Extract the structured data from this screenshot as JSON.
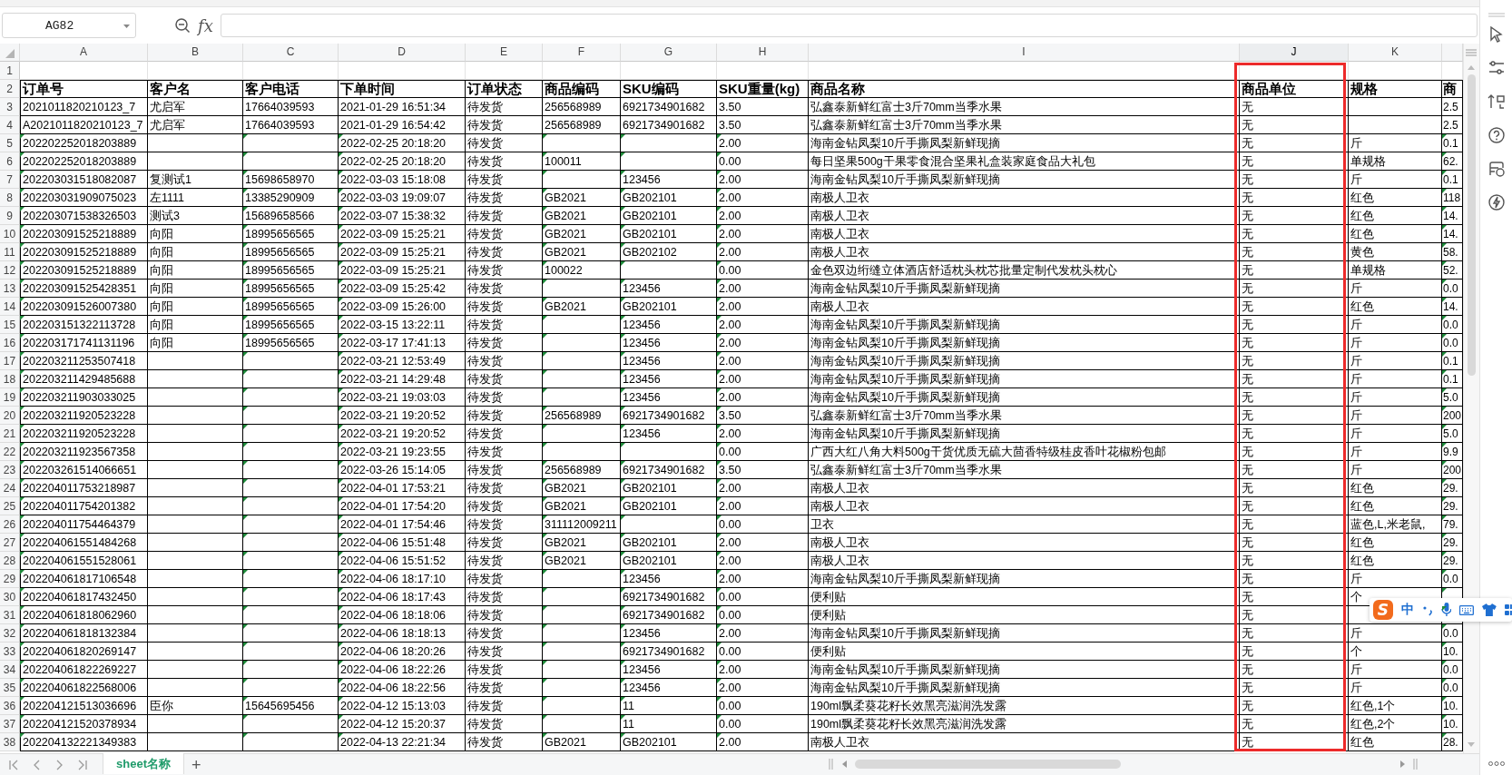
{
  "name_box": {
    "value": "AG82"
  },
  "formula_bar": {
    "fx": "fx"
  },
  "columns": [
    {
      "letter": "A",
      "highlighted": false,
      "flag_marks": true
    },
    {
      "letter": "B",
      "highlighted": false,
      "flag_marks": false
    },
    {
      "letter": "C",
      "highlighted": false,
      "flag_marks": true
    },
    {
      "letter": "D",
      "highlighted": false,
      "flag_marks": true
    },
    {
      "letter": "E",
      "highlighted": false,
      "flag_marks": false
    },
    {
      "letter": "F",
      "highlighted": false,
      "flag_marks": true
    },
    {
      "letter": "G",
      "highlighted": false,
      "flag_marks": true
    },
    {
      "letter": "H",
      "highlighted": false,
      "flag_marks": true
    },
    {
      "letter": "I",
      "highlighted": false,
      "flag_marks": false
    },
    {
      "letter": "J",
      "highlighted": true,
      "flag_marks": false
    },
    {
      "letter": "K",
      "highlighted": false,
      "flag_marks": false
    },
    {
      "highlighted": false,
      "flag_marks": true
    }
  ],
  "rows": [
    {
      "number": "1",
      "kind": "blank"
    },
    {
      "number": "2",
      "kind": "header",
      "cells": [
        "订单号",
        "客户名",
        "客户电话",
        "下单时间",
        "订单状态",
        "商品编码",
        "SKU编码",
        "SKU重量(kg)",
        "商品名称",
        "商品单位",
        "规格",
        "商"
      ]
    },
    {
      "number": "3",
      "kind": "data",
      "flagged": false,
      "cells": [
        "2021011820210123_7",
        "尤启军",
        "17664039593",
        "2021-01-29 16:51:34",
        "待发货",
        "256568989",
        "6921734901682",
        "3.50",
        "弘鑫泰新鲜红富士3斤70mm当季水果",
        "无",
        null,
        "2.5"
      ]
    },
    {
      "number": "4",
      "kind": "data",
      "flagged": false,
      "cells": [
        "A2021011820210123_7",
        "尤启军",
        "17664039593",
        "2021-01-29 16:54:42",
        "待发货",
        "256568989",
        "6921734901682",
        "3.50",
        "弘鑫泰新鲜红富士3斤70mm当季水果",
        "无",
        null,
        "2.5"
      ]
    },
    {
      "number": "5",
      "kind": "data",
      "flagged": true,
      "cells": [
        "202202252018203889",
        null,
        null,
        "2022-02-25 20:18:20",
        "待发货",
        null,
        null,
        "2.00",
        "海南金钻凤梨10斤手撕凤梨新鲜现摘",
        "无",
        "斤",
        "0.1"
      ]
    },
    {
      "number": "6",
      "kind": "data",
      "flagged": true,
      "cells": [
        "202202252018203889",
        null,
        null,
        "2022-02-25 20:18:20",
        "待发货",
        "100011",
        null,
        "0.00",
        "每日坚果500g干果零食混合坚果礼盒装家庭食品大礼包",
        "无",
        "单规格",
        "62."
      ]
    },
    {
      "number": "7",
      "kind": "data",
      "flagged": true,
      "cells": [
        "202203031518082087",
        "复测试1",
        "15698658970",
        "2022-03-03 15:18:08",
        "待发货",
        null,
        "123456",
        "2.00",
        "海南金钻凤梨10斤手撕凤梨新鲜现摘",
        "无",
        "斤",
        "0.1"
      ]
    },
    {
      "number": "8",
      "kind": "data",
      "flagged": true,
      "cells": [
        "202203031909075023",
        "左1111",
        "13385290909",
        "2022-03-03 19:09:07",
        "待发货",
        "GB2021",
        "GB202101",
        "2.00",
        "南极人卫衣",
        "无",
        "红色",
        "118"
      ]
    },
    {
      "number": "9",
      "kind": "data",
      "flagged": true,
      "cells": [
        "202203071538326503",
        "测试3",
        "15689658566",
        "2022-03-07 15:38:32",
        "待发货",
        "GB2021",
        "GB202101",
        "2.00",
        "南极人卫衣",
        "无",
        "红色",
        "14."
      ]
    },
    {
      "number": "10",
      "kind": "data",
      "flagged": true,
      "cells": [
        "202203091525218889",
        "向阳",
        "18995656565",
        "2022-03-09 15:25:21",
        "待发货",
        "GB2021",
        "GB202101",
        "2.00",
        "南极人卫衣",
        "无",
        "红色",
        "14."
      ]
    },
    {
      "number": "11",
      "kind": "data",
      "flagged": true,
      "cells": [
        "202203091525218889",
        "向阳",
        "18995656565",
        "2022-03-09 15:25:21",
        "待发货",
        "GB2021",
        "GB202102",
        "2.00",
        "南极人卫衣",
        "无",
        "黄色",
        "58."
      ]
    },
    {
      "number": "12",
      "kind": "data",
      "flagged": true,
      "cells": [
        "202203091525218889",
        "向阳",
        "18995656565",
        "2022-03-09 15:25:21",
        "待发货",
        "100022",
        null,
        "0.00",
        "金色双边绗缝立体酒店舒适枕头枕芯批量定制代发枕头枕心",
        "无",
        "单规格",
        "52."
      ]
    },
    {
      "number": "13",
      "kind": "data",
      "flagged": true,
      "cells": [
        "202203091525428351",
        "向阳",
        "18995656565",
        "2022-03-09 15:25:42",
        "待发货",
        null,
        "123456",
        "2.00",
        "海南金钻凤梨10斤手撕凤梨新鲜现摘",
        "无",
        "斤",
        "0.0"
      ]
    },
    {
      "number": "14",
      "kind": "data",
      "flagged": true,
      "cells": [
        "202203091526007380",
        "向阳",
        "18995656565",
        "2022-03-09 15:26:00",
        "待发货",
        "GB2021",
        "GB202101",
        "2.00",
        "南极人卫衣",
        "无",
        "红色",
        "14."
      ]
    },
    {
      "number": "15",
      "kind": "data",
      "flagged": true,
      "cells": [
        "202203151322113728",
        "向阳",
        "18995656565",
        "2022-03-15 13:22:11",
        "待发货",
        null,
        "123456",
        "2.00",
        "海南金钻凤梨10斤手撕凤梨新鲜现摘",
        "无",
        "斤",
        "0.0"
      ]
    },
    {
      "number": "16",
      "kind": "data",
      "flagged": true,
      "cells": [
        "202203171741131196",
        "向阳",
        "18995656565",
        "2022-03-17 17:41:13",
        "待发货",
        null,
        "123456",
        "2.00",
        "海南金钻凤梨10斤手撕凤梨新鲜现摘",
        "无",
        "斤",
        "0.0"
      ]
    },
    {
      "number": "17",
      "kind": "data",
      "flagged": true,
      "cells": [
        "202203211253507418",
        null,
        null,
        "2022-03-21 12:53:49",
        "待发货",
        null,
        "123456",
        "2.00",
        "海南金钻凤梨10斤手撕凤梨新鲜现摘",
        "无",
        "斤",
        "0.1"
      ]
    },
    {
      "number": "18",
      "kind": "data",
      "flagged": true,
      "cells": [
        "202203211429485688",
        null,
        null,
        "2022-03-21 14:29:48",
        "待发货",
        null,
        "123456",
        "2.00",
        "海南金钻凤梨10斤手撕凤梨新鲜现摘",
        "无",
        "斤",
        "0.1"
      ]
    },
    {
      "number": "19",
      "kind": "data",
      "flagged": true,
      "cells": [
        "202203211903033025",
        null,
        null,
        "2022-03-21 19:03:03",
        "待发货",
        null,
        "123456",
        "2.00",
        "海南金钻凤梨10斤手撕凤梨新鲜现摘",
        "无",
        "斤",
        "5.0"
      ]
    },
    {
      "number": "20",
      "kind": "data",
      "flagged": true,
      "cells": [
        "202203211920523228",
        null,
        null,
        "2022-03-21 19:20:52",
        "待发货",
        "256568989",
        "6921734901682",
        "3.50",
        "弘鑫泰新鲜红富士3斤70mm当季水果",
        "无",
        "斤",
        "200"
      ]
    },
    {
      "number": "21",
      "kind": "data",
      "flagged": true,
      "cells": [
        "202203211920523228",
        null,
        null,
        "2022-03-21 19:20:52",
        "待发货",
        null,
        "123456",
        "2.00",
        "海南金钻凤梨10斤手撕凤梨新鲜现摘",
        "无",
        "斤",
        "5.0"
      ]
    },
    {
      "number": "22",
      "kind": "data",
      "flagged": true,
      "cells": [
        "202203211923567358",
        null,
        null,
        "2022-03-21 19:23:55",
        "待发货",
        null,
        null,
        "0.00",
        "广西大红八角大料500g干货优质无硫大茴香特级桂皮香叶花椒粉包邮",
        "无",
        "斤",
        "9.9"
      ]
    },
    {
      "number": "23",
      "kind": "data",
      "flagged": true,
      "cells": [
        "202203261514066651",
        null,
        null,
        "2022-03-26 15:14:05",
        "待发货",
        "256568989",
        "6921734901682",
        "3.50",
        "弘鑫泰新鲜红富士3斤70mm当季水果",
        "无",
        "斤",
        "200"
      ]
    },
    {
      "number": "24",
      "kind": "data",
      "flagged": true,
      "cells": [
        "202204011753218987",
        null,
        null,
        "2022-04-01 17:53:21",
        "待发货",
        "GB2021",
        "GB202101",
        "2.00",
        "南极人卫衣",
        "无",
        "红色",
        "29."
      ]
    },
    {
      "number": "25",
      "kind": "data",
      "flagged": true,
      "cells": [
        "202204011754201382",
        null,
        null,
        "2022-04-01 17:54:20",
        "待发货",
        "GB2021",
        "GB202101",
        "2.00",
        "南极人卫衣",
        "无",
        "红色",
        "29."
      ]
    },
    {
      "number": "26",
      "kind": "data",
      "flagged": true,
      "cells": [
        "202204011754464379",
        null,
        null,
        "2022-04-01 17:54:46",
        "待发货",
        "311112009211",
        null,
        "0.00",
        "卫衣",
        "无",
        "蓝色,L,米老鼠,",
        "79."
      ]
    },
    {
      "number": "27",
      "kind": "data",
      "flagged": true,
      "cells": [
        "202204061551484268",
        null,
        null,
        "2022-04-06 15:51:48",
        "待发货",
        "GB2021",
        "GB202101",
        "2.00",
        "南极人卫衣",
        "无",
        "红色",
        "29."
      ]
    },
    {
      "number": "28",
      "kind": "data",
      "flagged": true,
      "cells": [
        "202204061551528061",
        null,
        null,
        "2022-04-06 15:51:52",
        "待发货",
        "GB2021",
        "GB202101",
        "2.00",
        "南极人卫衣",
        "无",
        "红色",
        "29."
      ]
    },
    {
      "number": "29",
      "kind": "data",
      "flagged": true,
      "cells": [
        "202204061817106548",
        null,
        null,
        "2022-04-06 18:17:10",
        "待发货",
        null,
        "123456",
        "2.00",
        "海南金钻凤梨10斤手撕凤梨新鲜现摘",
        "无",
        "斤",
        "0.0"
      ]
    },
    {
      "number": "30",
      "kind": "data",
      "flagged": true,
      "cells": [
        "202204061817432450",
        null,
        null,
        "2022-04-06 18:17:43",
        "待发货",
        null,
        "6921734901682",
        "0.00",
        "便利贴",
        "无",
        "个",
        null
      ]
    },
    {
      "number": "31",
      "kind": "data",
      "flagged": true,
      "cells": [
        "202204061818062960",
        null,
        null,
        "2022-04-06 18:18:06",
        "待发货",
        null,
        "6921734901682",
        "0.00",
        "便利贴",
        "无",
        null,
        null
      ]
    },
    {
      "number": "32",
      "kind": "data",
      "flagged": true,
      "cells": [
        "202204061818132384",
        null,
        null,
        "2022-04-06 18:18:13",
        "待发货",
        null,
        "123456",
        "2.00",
        "海南金钻凤梨10斤手撕凤梨新鲜现摘",
        "无",
        "斤",
        "0.0"
      ]
    },
    {
      "number": "33",
      "kind": "data",
      "flagged": true,
      "cells": [
        "202204061820269147",
        null,
        null,
        "2022-04-06 18:20:26",
        "待发货",
        null,
        "6921734901682",
        "0.00",
        "便利贴",
        "无",
        "个",
        "10."
      ]
    },
    {
      "number": "34",
      "kind": "data",
      "flagged": true,
      "cells": [
        "202204061822269227",
        null,
        null,
        "2022-04-06 18:22:26",
        "待发货",
        null,
        "123456",
        "2.00",
        "海南金钻凤梨10斤手撕凤梨新鲜现摘",
        "无",
        "斤",
        "0.0"
      ]
    },
    {
      "number": "35",
      "kind": "data",
      "flagged": true,
      "cells": [
        "202204061822568006",
        null,
        null,
        "2022-04-06 18:22:56",
        "待发货",
        null,
        "123456",
        "2.00",
        "海南金钻凤梨10斤手撕凤梨新鲜现摘",
        "无",
        "斤",
        "0.0"
      ]
    },
    {
      "number": "36",
      "kind": "data",
      "flagged": true,
      "cells": [
        "202204121513036696",
        "臣你",
        "15645695456",
        "2022-04-12 15:13:03",
        "待发货",
        null,
        "11",
        "0.00",
        "190ml飘柔葵花籽长效黑亮滋润洗发露",
        "无",
        "红色,1个",
        "10."
      ]
    },
    {
      "number": "37",
      "kind": "data",
      "flagged": true,
      "cells": [
        "202204121520378934",
        null,
        null,
        "2022-04-12 15:20:37",
        "待发货",
        null,
        "11",
        "0.00",
        "190ml飘柔葵花籽长效黑亮滋润洗发露",
        "无",
        "红色,2个",
        "10."
      ]
    },
    {
      "number": "38",
      "kind": "data",
      "flagged": true,
      "cells": [
        "202204132221349383",
        null,
        null,
        "2022-04-13 22:21:34",
        "待发货",
        "GB2021",
        "GB202101",
        "2.00",
        "南极人卫衣",
        "无",
        "红色",
        "28."
      ]
    }
  ],
  "sheet_tabs": [
    {
      "label": "sheet名称",
      "selected": true
    }
  ],
  "add_sheet": "+",
  "ime_toolbar": {
    "logo": "S",
    "mode": "中"
  }
}
